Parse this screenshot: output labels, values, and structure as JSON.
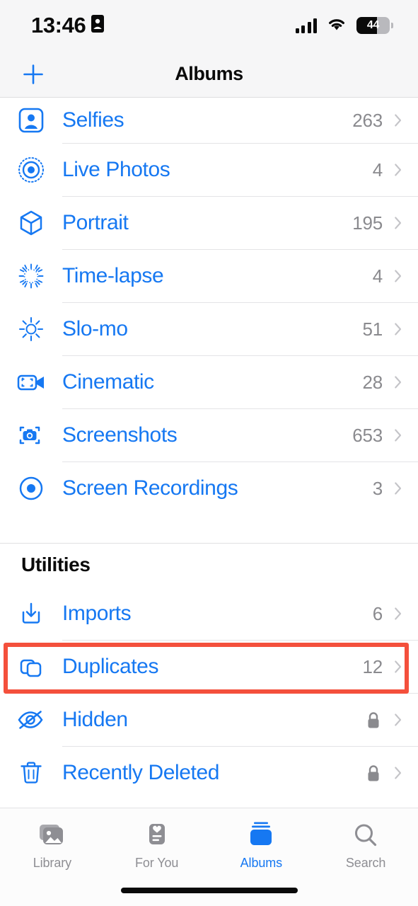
{
  "status_bar": {
    "time": "13:46",
    "recording_icon": "id-card-icon",
    "signal_icon": "cellular-signal-icon",
    "wifi_icon": "wifi-icon",
    "battery_percent": "44",
    "battery_level": 44
  },
  "nav": {
    "add_icon": "plus-icon",
    "title": "Albums"
  },
  "media_types": {
    "rows": [
      {
        "label": "Selfies",
        "count": "263",
        "icon": "selfies-icon"
      },
      {
        "label": "Live Photos",
        "count": "4",
        "icon": "live-photos-icon"
      },
      {
        "label": "Portrait",
        "count": "195",
        "icon": "portrait-cube-icon"
      },
      {
        "label": "Time-lapse",
        "count": "4",
        "icon": "timelapse-icon"
      },
      {
        "label": "Slo-mo",
        "count": "51",
        "icon": "slomo-icon"
      },
      {
        "label": "Cinematic",
        "count": "28",
        "icon": "cinematic-icon"
      },
      {
        "label": "Screenshots",
        "count": "653",
        "icon": "screenshots-icon"
      },
      {
        "label": "Screen Recordings",
        "count": "3",
        "icon": "screen-recordings-icon"
      }
    ]
  },
  "utilities": {
    "header": "Utilities",
    "rows": [
      {
        "label": "Imports",
        "count": "6",
        "icon": "imports-icon",
        "locked": false
      },
      {
        "label": "Duplicates",
        "count": "12",
        "icon": "duplicates-icon",
        "locked": false
      },
      {
        "label": "Hidden",
        "count": "",
        "icon": "hidden-eye-icon",
        "locked": true
      },
      {
        "label": "Recently Deleted",
        "count": "",
        "icon": "trash-icon",
        "locked": true
      }
    ]
  },
  "highlight": {
    "target_label": "Duplicates",
    "color": "#F4503C"
  },
  "tabbar": {
    "tabs": [
      {
        "label": "Library",
        "icon": "library-icon",
        "active": false
      },
      {
        "label": "For You",
        "icon": "for-you-icon",
        "active": false
      },
      {
        "label": "Albums",
        "icon": "albums-icon",
        "active": true
      },
      {
        "label": "Search",
        "icon": "search-icon",
        "active": false
      }
    ]
  },
  "colors": {
    "accent_blue": "#1678F2",
    "count_gray": "#8A8A8E",
    "chevron_gray": "#C4C4C8",
    "highlight_red": "#F4503C",
    "bar_bg": "#F6F6F7"
  }
}
